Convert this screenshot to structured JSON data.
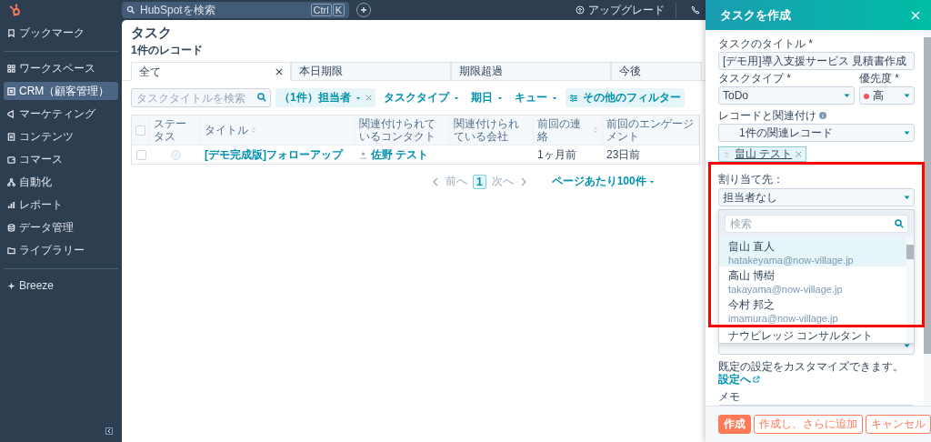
{
  "sidebar": {
    "sections": [
      {
        "items": [
          {
            "label": "ブックマーク",
            "selected": false
          }
        ]
      },
      {
        "items": [
          {
            "label": "ワークスペース",
            "selected": false
          },
          {
            "label": "CRM（顧客管理）",
            "selected": true
          },
          {
            "label": "マーケティング",
            "selected": false
          },
          {
            "label": "コンテンツ",
            "selected": false
          },
          {
            "label": "コマース",
            "selected": false
          },
          {
            "label": "自動化",
            "selected": false
          },
          {
            "label": "レポート",
            "selected": false
          },
          {
            "label": "データ管理",
            "selected": false
          },
          {
            "label": "ライブラリー",
            "selected": false
          }
        ]
      },
      {
        "items": [
          {
            "label": "Breeze",
            "selected": false
          }
        ]
      }
    ]
  },
  "top_bar": {
    "search": {
      "placeholder": "HubSpotを検索"
    },
    "shortcut": [
      "Ctrl",
      "K"
    ],
    "upgrade": "アップグレード"
  },
  "page": {
    "title": "タスク",
    "subtitle": "1件のレコード",
    "tabs": [
      {
        "label": "全て",
        "selected": true
      },
      {
        "label": "本日期限",
        "selected": false
      },
      {
        "label": "期限超過",
        "selected": false
      },
      {
        "label": "今後",
        "selected": false
      }
    ],
    "search": {
      "placeholder": "タスクタイトルを検索"
    },
    "filters": [
      {
        "kind": "active",
        "label": "（1件）担当者"
      },
      {
        "kind": "dropdown",
        "label": "タスクタイプ"
      },
      {
        "kind": "dropdown",
        "label": "期日"
      },
      {
        "kind": "dropdown",
        "label": "キュー"
      },
      {
        "kind": "button",
        "label": "その他のフィルター"
      }
    ],
    "table": {
      "select_all_checked": false,
      "columns": [
        {
          "label": "ステータス",
          "sortable": false
        },
        {
          "label": "タイトル",
          "sortable": true
        },
        {
          "label": "関連付けられているコンタクト",
          "sortable": false
        },
        {
          "label": "関連付けられている会社",
          "sortable": false
        },
        {
          "label": "前回の連絡",
          "sortable": true
        },
        {
          "label": "前回のエンゲージメント",
          "sortable": false
        }
      ],
      "rows": [
        {
          "checked": false,
          "completed": false,
          "title": "[デモ完成版]フォローアップ",
          "contact": "佐野 テスト",
          "last_contact": "1ヶ月前",
          "last_engagement": "23日前"
        }
      ]
    },
    "pagination": {
      "prev": "前へ",
      "page": "1",
      "next": "次へ",
      "per_page": "ページあたり100件"
    }
  },
  "panel": {
    "title": "タスクを作成",
    "task_title": {
      "label": "タスクのタイトル *",
      "value": "[デモ用]導入支援サービス 見積書作成"
    },
    "task_type": {
      "label": "タスクタイプ *",
      "value": "ToDo"
    },
    "priority": {
      "label": "優先度 *",
      "value": "高"
    },
    "association": {
      "label": "レコードと関連付け",
      "value": "1件の関連レコード",
      "chips": [
        "畠山 テスト"
      ]
    },
    "assignee": {
      "label": "割り当て先：",
      "value": "担当者なし",
      "search_placeholder": "検索",
      "options": [
        {
          "name": "畠山 直人",
          "email": "hatakeyama@now-village.jp",
          "selected": true
        },
        {
          "name": "高山 博樹",
          "email": "takayama@now-village.jp",
          "selected": false
        },
        {
          "name": "今村 邦之",
          "email": "imamura@now-village.jp",
          "selected": false
        },
        {
          "name": "ナウビレッジ コンサルタント",
          "selected": false
        }
      ]
    },
    "hint": "既定の設定をカスタマイズできます。",
    "hint_link": "設定へ",
    "memo": {
      "label": "メモ"
    },
    "buttons": [
      {
        "kind": "primary",
        "label": "作成"
      },
      {
        "kind": "secondary",
        "label": "作成し、さらに追加"
      },
      {
        "kind": "secondary",
        "label": "キャンセル"
      }
    ]
  }
}
